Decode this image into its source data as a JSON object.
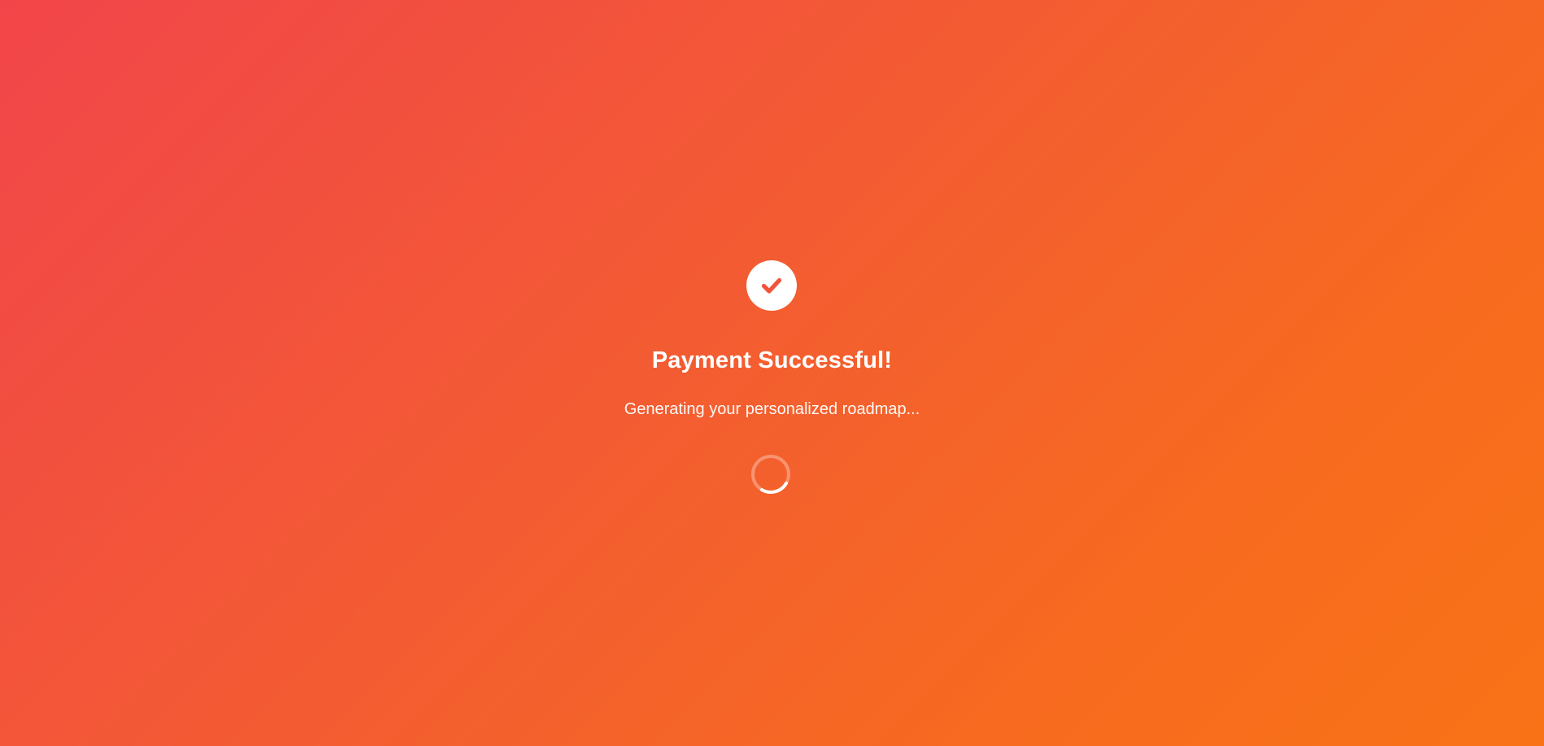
{
  "status": {
    "title": "Payment Successful!",
    "message": "Generating your personalized roadmap..."
  },
  "icons": {
    "success": "checkmark-icon",
    "loading": "loading-spinner-icon"
  },
  "colors": {
    "gradient_start": "#f2454a",
    "gradient_end": "#f97316",
    "foreground": "#ffffff",
    "checkmark": "#f2543a"
  }
}
